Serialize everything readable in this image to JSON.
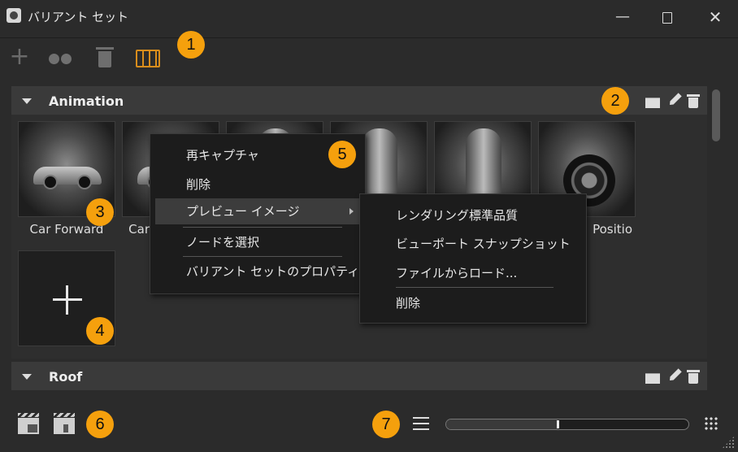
{
  "window": {
    "title": "バリアント セット",
    "minimize": "—",
    "close": "✕"
  },
  "badges": [
    "1",
    "2",
    "3",
    "4",
    "5",
    "6",
    "7"
  ],
  "groups": [
    {
      "title": "Animation",
      "thumbnails": [
        {
          "label": "Car Forward",
          "image": "car-side-view"
        },
        {
          "label": "Car",
          "image": "car-side-view"
        },
        {
          "label": "",
          "image": "car-top-view"
        },
        {
          "label": "",
          "image": "car-top-view"
        },
        {
          "label": "",
          "image": "car-top-view"
        },
        {
          "label": "Positio",
          "image": "car-wheel-closeup"
        }
      ]
    },
    {
      "title": "Roof",
      "thumbnails": []
    }
  ],
  "context_menu": {
    "items": [
      {
        "label": "再キャプチャ"
      },
      {
        "label": "削除"
      },
      {
        "label": "プレビュー イメージ",
        "has_submenu": true,
        "highlighted": true
      },
      {
        "label": "ノードを選択"
      },
      {
        "label": "バリアント セットのプロパティ..."
      }
    ]
  },
  "submenu": {
    "items": [
      {
        "label": "レンダリング標準品質"
      },
      {
        "label": "ビューポート スナップショット"
      },
      {
        "label": "ファイルからロード..."
      },
      {
        "label": "削除"
      }
    ]
  },
  "thumbnail_size_slider": {
    "value": 0.46
  },
  "colors": {
    "accent": "#f5a00d",
    "active_tool": "#d98d1c",
    "background": "#2b2b2b"
  },
  "icons": {
    "toolbar": [
      "plus-icon",
      "link-dots-icon",
      "trash-icon",
      "grid-view-icon"
    ],
    "group": [
      "clapperboard-icon",
      "pencil-icon",
      "trash-icon"
    ],
    "bottom": [
      "clapperboard-image-icon",
      "clapperboard-play-icon",
      "list-view-icon",
      "grid-dots-icon"
    ]
  }
}
